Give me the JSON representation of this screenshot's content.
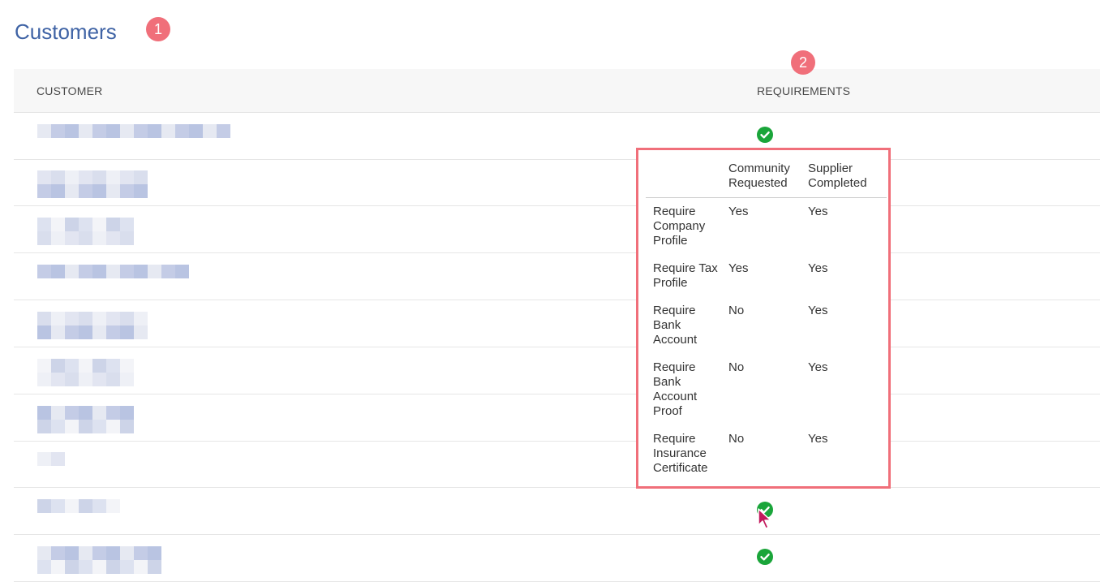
{
  "header": {
    "title": "Customers"
  },
  "annotations": {
    "badge_1": "1",
    "badge_2": "2"
  },
  "table": {
    "columns": [
      "CUSTOMER",
      "REQUIREMENTS"
    ],
    "rows": [
      {
        "status": "complete"
      },
      {
        "status": "complete"
      },
      {
        "status": "complete"
      },
      {
        "status": "complete"
      },
      {
        "status": "complete"
      },
      {
        "status": "complete"
      },
      {
        "status": "complete"
      },
      {
        "status": "complete"
      },
      {
        "status": "complete"
      },
      {
        "status": "complete"
      }
    ]
  },
  "popup": {
    "col_community": "Community Requested",
    "col_supplier": "Supplier Completed",
    "items": [
      {
        "label": "Require Company Profile",
        "community": "Yes",
        "supplier": "Yes"
      },
      {
        "label": "Require Tax Profile",
        "community": "Yes",
        "supplier": "Yes"
      },
      {
        "label": "Require Bank Account",
        "community": "No",
        "supplier": "Yes"
      },
      {
        "label": "Require Bank Account Proof",
        "community": "No",
        "supplier": "Yes"
      },
      {
        "label": "Require Insurance Certificate",
        "community": "No",
        "supplier": "Yes"
      }
    ]
  },
  "icons": {
    "status": "check-circle-icon",
    "pointer": "mouse-cursor-icon"
  },
  "colors": {
    "title": "#3f63a5",
    "badge": "#f06f7a",
    "check": "#1aa53a",
    "popup_border": "#f06f7a",
    "header_bg": "#f7f7f7",
    "cursor": "#c2185b"
  }
}
